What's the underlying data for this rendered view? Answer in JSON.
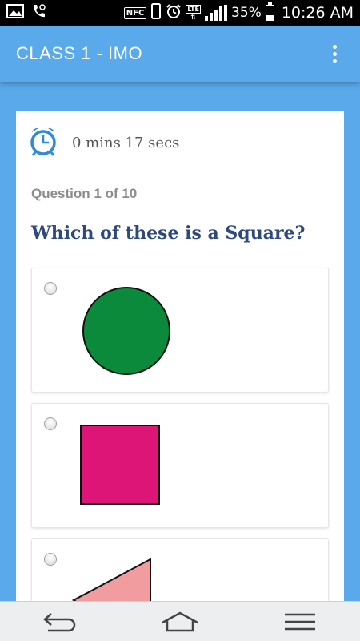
{
  "status_bar": {
    "icons": [
      "image-icon",
      "phone-icon",
      "nfc-icon",
      "vibrate-icon",
      "alarm-icon",
      "lte-icon",
      "signal-icon",
      "battery-icon"
    ],
    "nfc_label": "NFC",
    "lte_label": "LTE",
    "battery_percent": "35%",
    "battery_level": 0.35,
    "time": "10:26 AM"
  },
  "app_bar": {
    "title": "CLASS 1 - IMO",
    "menu_icon": "more-vert-icon"
  },
  "quiz": {
    "timer_icon": "alarm-clock-icon",
    "timer_text": "0 mins 17 secs",
    "question_number": "Question 1 of 10",
    "question_text": "Which of these is a Square?",
    "options": [
      {
        "shape": "circle",
        "color": "#0b8a3c",
        "selected": false
      },
      {
        "shape": "square",
        "color": "#dd1577",
        "selected": false
      },
      {
        "shape": "triangle",
        "color": "#f19c9f",
        "selected": false
      }
    ]
  },
  "nav_bar": {
    "buttons": [
      "back-icon",
      "home-icon",
      "menu-icon"
    ]
  },
  "colors": {
    "accent": "#5aa9ea",
    "question_text": "#2e4a7d",
    "timer_icon": "#2e8bd8"
  }
}
